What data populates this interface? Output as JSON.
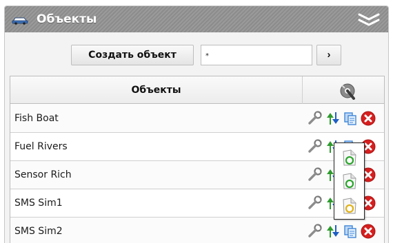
{
  "panel": {
    "title": "Объекты",
    "title_icon": "vehicle-icon",
    "collapse_icon": "double-chevron-down-icon"
  },
  "toolbar": {
    "create_button_label": "Создать объект",
    "search_value": "*",
    "go_button_label": "›"
  },
  "table": {
    "header_title": "Объекты",
    "header_icon": "settings-wrench-icon",
    "rows": [
      {
        "name": "Fish Boat"
      },
      {
        "name": "Fuel Rivers"
      },
      {
        "name": "Sensor Rich"
      },
      {
        "name": "SMS Sim1"
      },
      {
        "name": "SMS Sim2"
      }
    ],
    "row_actions": [
      "edit-wrench-icon",
      "import-export-arrows-icon",
      "copy-icon",
      "delete-icon"
    ]
  },
  "popup": {
    "items": [
      "document-green-refresh-icon",
      "document-green-refresh-icon",
      "document-yellow-refresh-icon"
    ]
  },
  "colors": {
    "title_bar": "#8c8c8c",
    "delete_red": "#d61f1f",
    "arrow_green": "#2e9b2e",
    "arrow_blue": "#1f5fc4",
    "copy_blue": "#3f86d8"
  }
}
